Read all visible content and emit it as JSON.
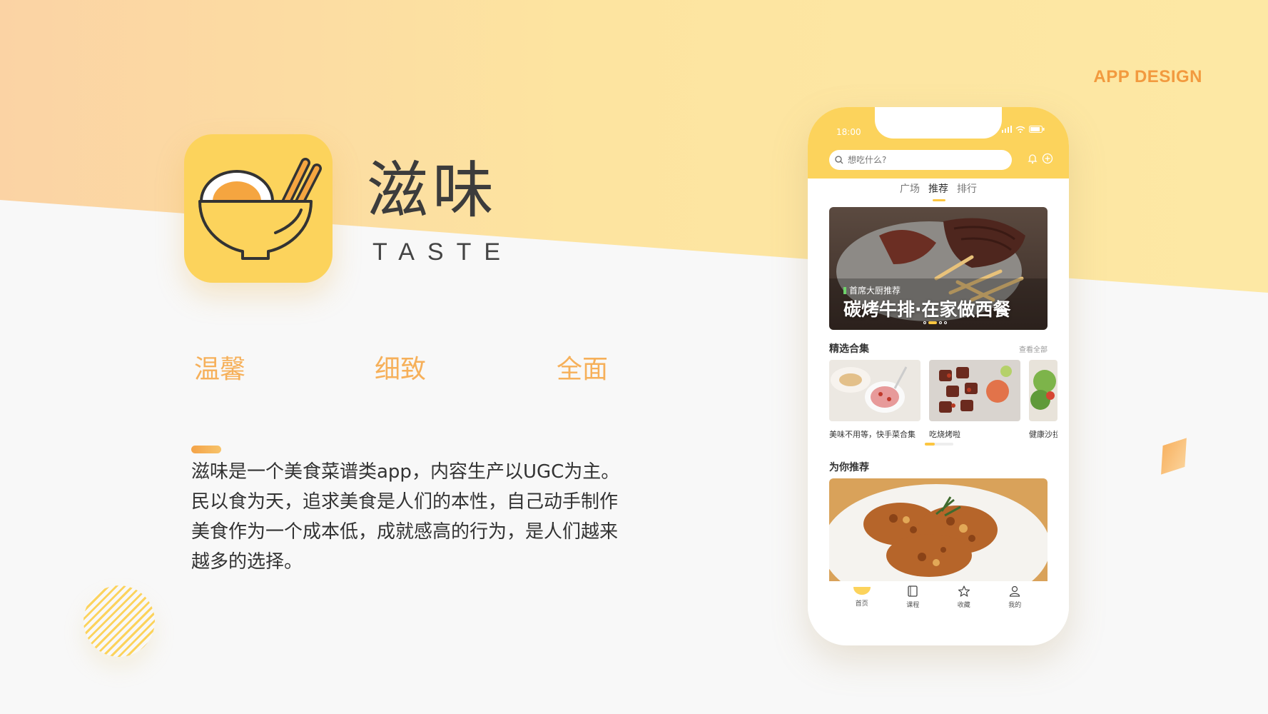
{
  "header": {
    "tag": "APP DESIGN"
  },
  "app": {
    "name": "滋味",
    "subtitle": "TASTE"
  },
  "keywords": [
    "温馨",
    "细致",
    "全面"
  ],
  "description": "滋味是一个美食菜谱类app，内容生产以UGC为主。民以食为天，追求美食是人们的本性，自己动手制作美食作为一个成本低，成就感高的行为，是人们越来越多的选择。",
  "phone": {
    "time": "18:00",
    "search_placeholder": "想吃什么?",
    "tabs": [
      "广场",
      "推荐",
      "排行"
    ],
    "active_tab": "推荐",
    "banner": {
      "tag": "首席大厨推荐",
      "title": "碳烤牛排·在家做西餐"
    },
    "collections": {
      "title": "精选合集",
      "more": "查看全部",
      "items": [
        "美味不用等，快手菜合集",
        "吃烧烤啦",
        "健康沙拉"
      ]
    },
    "recommend": {
      "title": "为你推荐"
    },
    "tabbar": [
      "首页",
      "课程",
      "收藏",
      "我的"
    ]
  },
  "colors": {
    "accent": "#fcd35c",
    "orange": "#f29a3f",
    "keyword": "#f6b05a"
  }
}
